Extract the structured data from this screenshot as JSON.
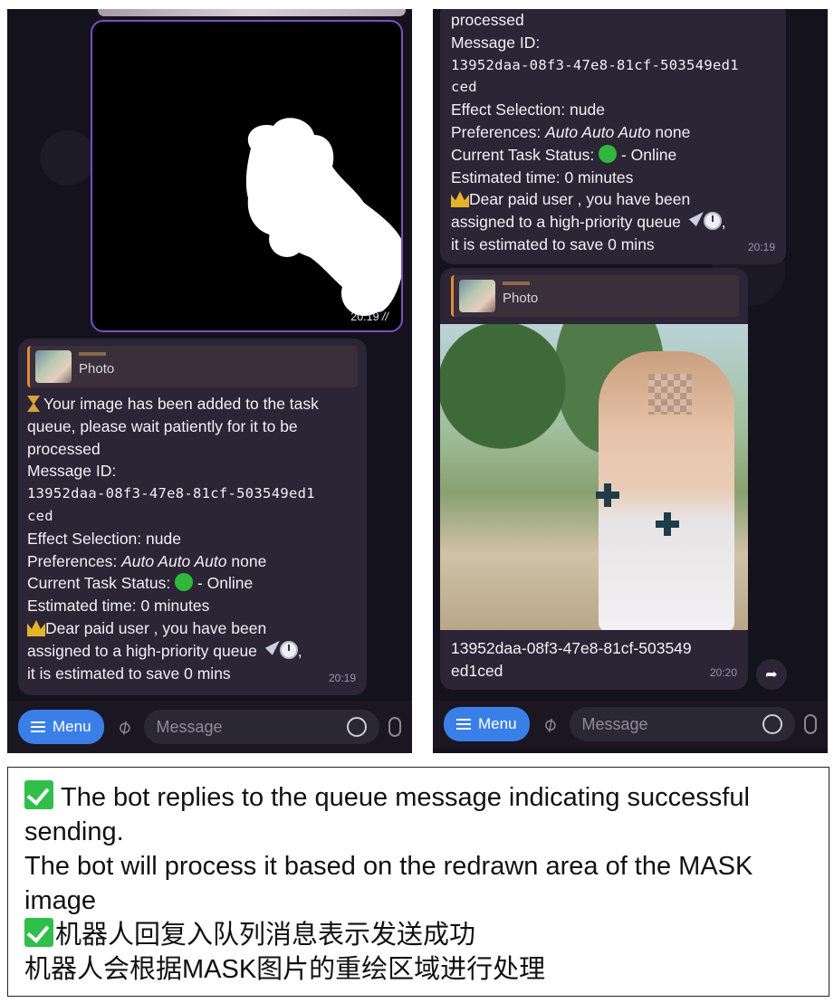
{
  "left": {
    "mask_time": "20:19",
    "mask_ticks": "//",
    "reply_label": "Photo",
    "lines": [
      "Your image has been added to the task",
      "queue, please wait patiently for it to be",
      "processed",
      "Message ID:",
      "13952daa-08f3-47e8-81cf-503549ed1",
      "ced",
      "Effect Selection: nude"
    ],
    "pref_label": "Preferences: ",
    "pref_italic": "Auto Auto Auto",
    "pref_tail": " none",
    "status_label": "Current Task Status: ",
    "status_tail": " - Online",
    "estimated": "Estimated time: 0 minutes",
    "paid_1": "Dear paid user , you have been",
    "paid_2": "assigned to a high-priority queue",
    "paid_3": "it is estimated to save 0 mins",
    "time": "20:19",
    "menu": "Menu",
    "placeholder": "Message"
  },
  "right": {
    "lines": [
      "processed",
      "Message ID:",
      "13952daa-08f3-47e8-81cf-503549ed1",
      "ced",
      "Effect Selection: nude"
    ],
    "pref_label": "Preferences: ",
    "pref_italic": "Auto Auto Auto",
    "pref_tail": " none",
    "status_label": "Current Task Status: ",
    "status_tail": " - Online",
    "estimated": "Estimated time: 0 minutes",
    "paid_1": "Dear paid user , you have been",
    "paid_2": "assigned to a high-priority queue",
    "paid_3": "it is estimated to save 0 mins",
    "time": "20:19",
    "reply_label": "Photo",
    "photo_caption_1": "13952daa-08f3-47e8-81cf-503549",
    "photo_caption_2": "ed1ced",
    "photo_time": "20:20",
    "menu": "Menu",
    "placeholder": "Message"
  },
  "caption": {
    "line1": "The bot replies to the queue message indicating successful",
    "line2": "sending.",
    "line3": "The bot will process it based on the redrawn area of the MASK",
    "line4": "image",
    "line5": "机器人回复入队列消息表示发送成功",
    "line6": "机器人会根据MASK图片的重绘区域进行处理"
  },
  "colors": {
    "accent": "#3a7fe8",
    "check": "#2fbf4a",
    "online": "#2fb83c",
    "bubble": "#2b2536"
  }
}
